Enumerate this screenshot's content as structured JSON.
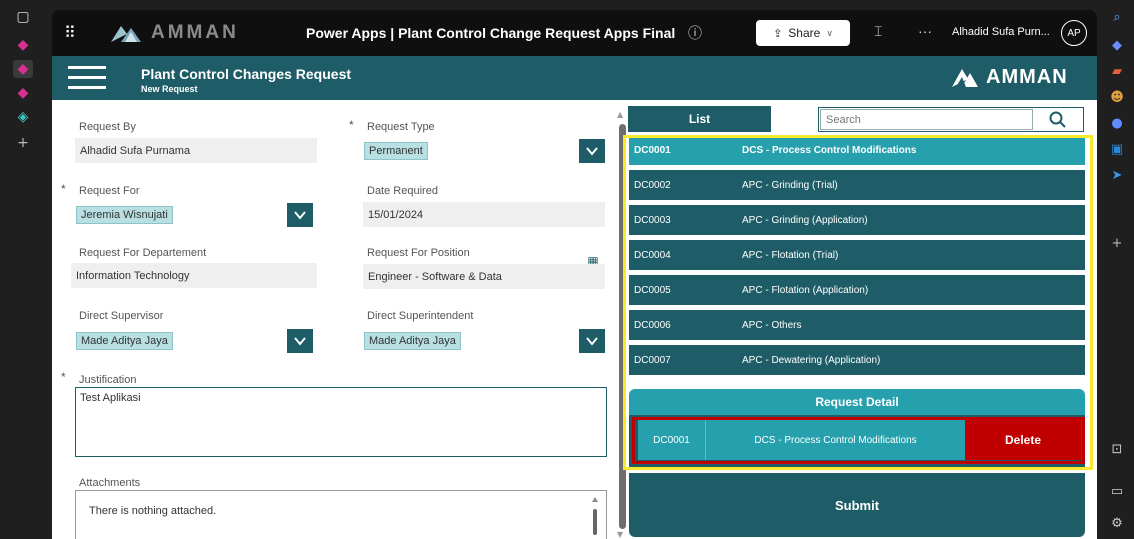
{
  "browser_rail": {
    "left_icons": [
      "sidebar-toggle-icon",
      "powerapps-icon",
      "powerapps-icon",
      "powerapps-icon",
      "copilot-icon",
      "plus-icon"
    ],
    "right_icons": [
      "search-icon",
      "gem-icon",
      "briefcase-icon",
      "people-icon",
      "copilot-icon",
      "outlook-icon",
      "send-icon",
      "plus-icon",
      "screen-icon",
      "panel-icon",
      "settings-icon"
    ]
  },
  "topbar": {
    "brand": "AMMAN",
    "app_title": "Power Apps  |  Plant Control Change Request Apps Final",
    "share_label": "Share",
    "user_name": "Alhadid Sufa Purn...",
    "avatar_initials": "AP"
  },
  "header": {
    "title": "Plant Control Changes Request",
    "subtitle": "New Request",
    "brand": "AMMAN"
  },
  "form": {
    "request_by": {
      "label": "Request By",
      "value": "Alhadid Sufa Purnama"
    },
    "request_type": {
      "required": "*",
      "label": "Request Type",
      "value": "Permanent"
    },
    "request_for": {
      "required": "*",
      "label": "Request For",
      "value": "Jeremia Wisnujati"
    },
    "date_required": {
      "label": "Date Required",
      "value": "15/01/2024"
    },
    "request_for_department": {
      "label": "Request For Departement",
      "value": "Information Technology"
    },
    "request_for_position": {
      "label": "Request For Position",
      "value": "Engineer - Software & Data"
    },
    "direct_supervisor": {
      "label": "Direct Supervisor",
      "value": "Made Aditya Jaya"
    },
    "direct_superintendent": {
      "label": "Direct Superintendent",
      "value": "Made Aditya Jaya"
    },
    "justification": {
      "required": "*",
      "label": "Justification",
      "value": "Test Aplikasi"
    },
    "attachments": {
      "label": "Attachments",
      "empty_text": "There is nothing attached."
    }
  },
  "list": {
    "tab_label": "List",
    "search_placeholder": "Search",
    "rows": [
      {
        "code": "DC0001",
        "desc": "DCS - Process Control Modifications",
        "selected": true
      },
      {
        "code": "DC0002",
        "desc": "APC - Grinding (Trial)",
        "selected": false
      },
      {
        "code": "DC0003",
        "desc": "APC - Grinding (Application)",
        "selected": false
      },
      {
        "code": "DC0004",
        "desc": "APC - Flotation (Trial)",
        "selected": false
      },
      {
        "code": "DC0005",
        "desc": "APC - Flotation (Application)",
        "selected": false
      },
      {
        "code": "DC0006",
        "desc": "APC - Others",
        "selected": false
      },
      {
        "code": "DC0007",
        "desc": "APC - Dewatering (Application)",
        "selected": false
      }
    ]
  },
  "detail": {
    "title": "Request Detail",
    "code": "DC0001",
    "desc": "DCS - Process Control Modifications",
    "delete_label": "Delete"
  },
  "submit_label": "Submit",
  "colors": {
    "primary": "#1e5d67",
    "accent": "#27a0ad",
    "danger": "#c00000",
    "highlight": "#f7e92b"
  }
}
